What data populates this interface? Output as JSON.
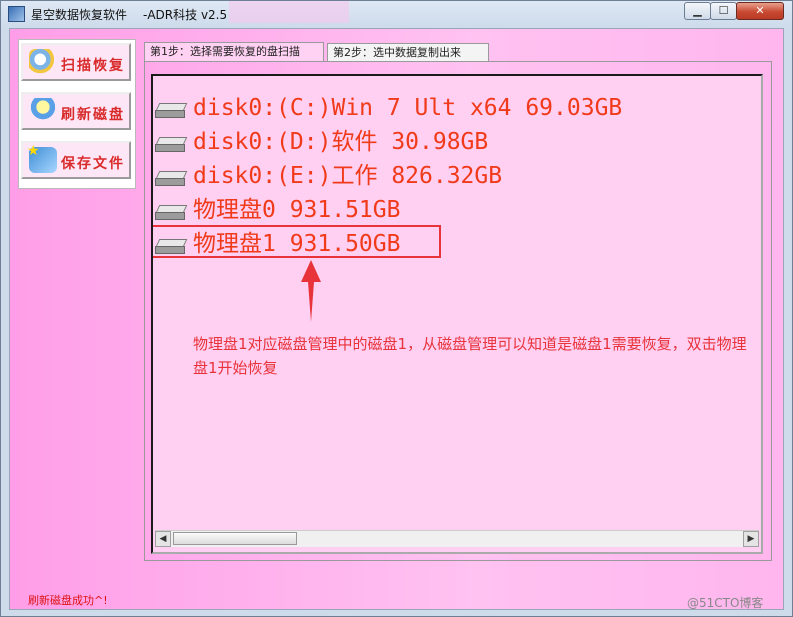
{
  "window": {
    "title": "星空数据恢复软件",
    "version": "-ADR科技 v2.5",
    "controls": {
      "minimize": "▁",
      "maximize": "☐",
      "close": "✕"
    }
  },
  "toolbar": {
    "buttons": [
      {
        "label": "扫描恢复",
        "icon": "scan-magnifier-icon"
      },
      {
        "label": "刷新磁盘",
        "icon": "refresh-disk-icon"
      },
      {
        "label": "保存文件",
        "icon": "save-file-icon"
      }
    ]
  },
  "tabs": [
    {
      "label": "第1步：选择需要恢复的盘扫描",
      "active": true
    },
    {
      "label": "第2步：选中数据复制出来",
      "active": false
    }
  ],
  "disks": [
    {
      "label": "disk0:(C:)Win 7 Ult x64 69.03GB",
      "icon": "hard-disk-icon"
    },
    {
      "label": "disk0:(D:)软件 30.98GB",
      "icon": "hard-disk-icon"
    },
    {
      "label": "disk0:(E:)工作 826.32GB",
      "icon": "hard-disk-icon"
    },
    {
      "label": "物理盘0 931.51GB",
      "icon": "hard-disk-icon"
    },
    {
      "label": "物理盘1 931.50GB",
      "icon": "hard-disk-icon"
    }
  ],
  "annotation": {
    "note": "物理盘1对应磁盘管理中的磁盘1，从磁盘管理可以知道是磁盘1需要恢复，双击物理盘1开始恢复",
    "color": "#e8333a"
  },
  "scrollbar": {
    "left_arrow": "◀",
    "right_arrow": "▶"
  },
  "status": {
    "text": "刷新磁盘成功^!"
  },
  "watermark": {
    "text": "@51CTO博客"
  }
}
